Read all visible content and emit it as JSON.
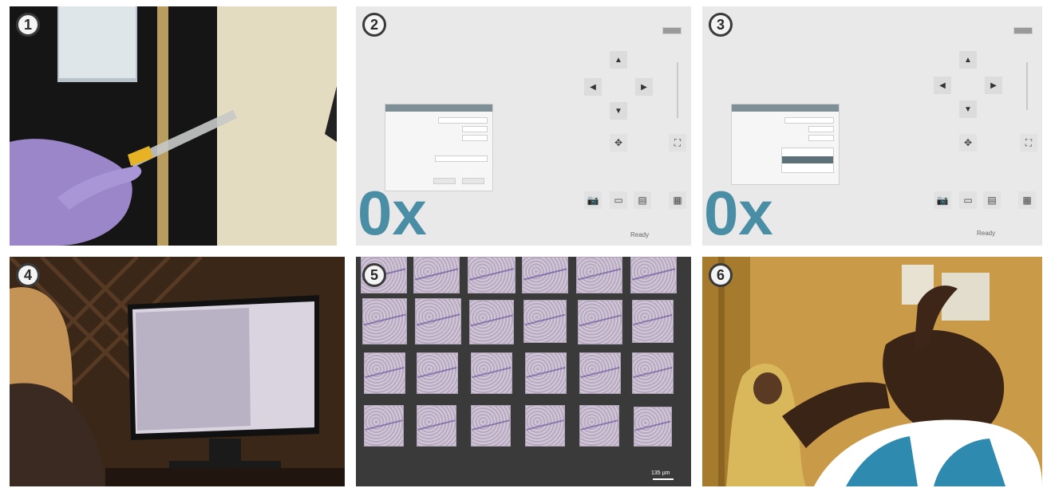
{
  "panels": [
    {
      "number": "1"
    },
    {
      "number": "2"
    },
    {
      "number": "3"
    },
    {
      "number": "4"
    },
    {
      "number": "5"
    },
    {
      "number": "6"
    }
  ],
  "software": {
    "logo_text": "0x",
    "status": "Ready"
  },
  "micrograph": {
    "scale_bar": "135 µm"
  }
}
